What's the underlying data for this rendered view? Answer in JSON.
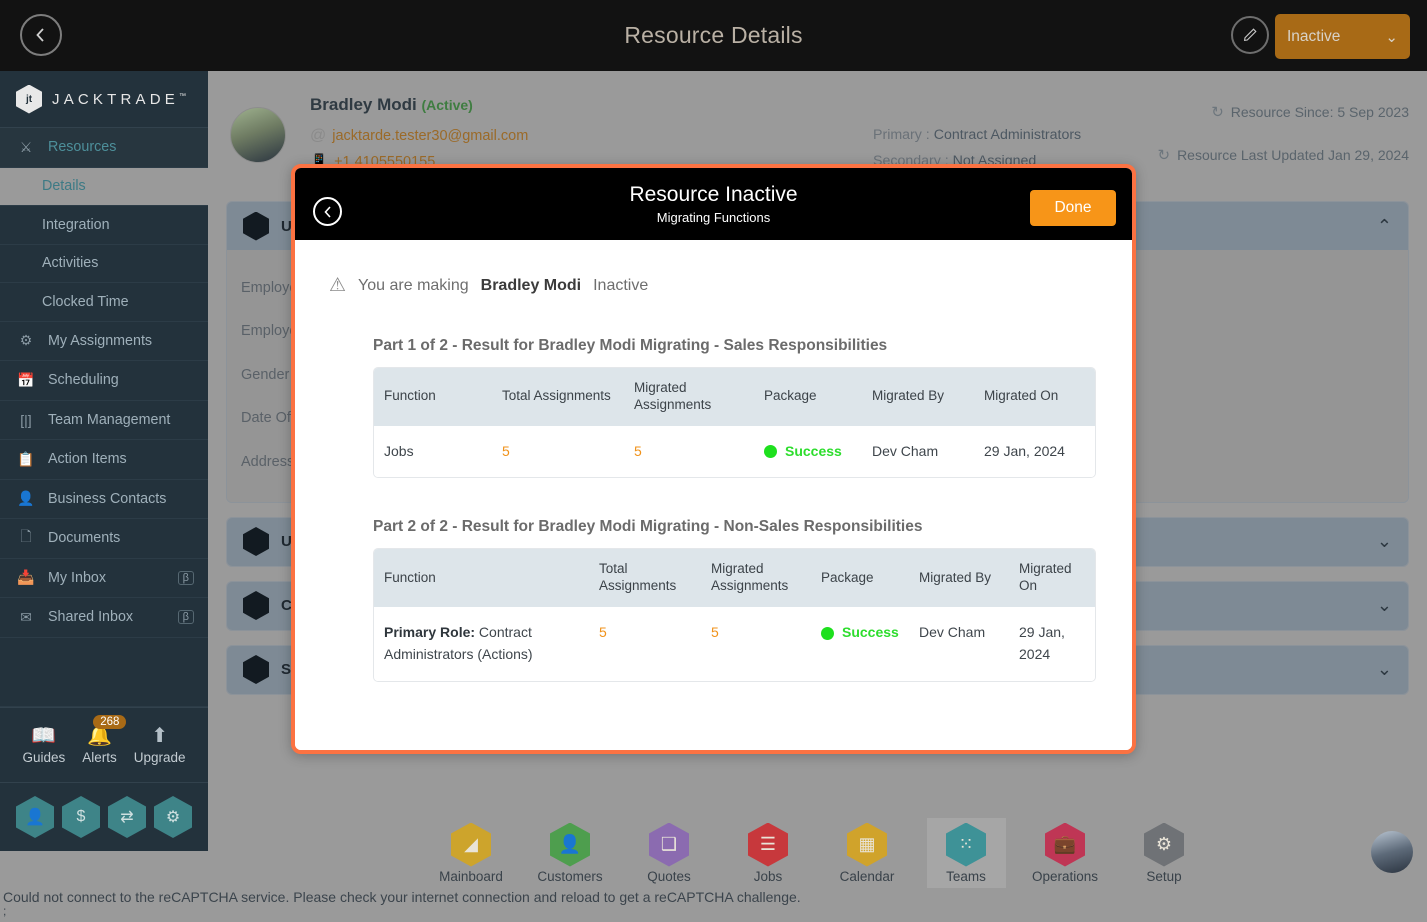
{
  "topbar": {
    "back_icon": "chevron-left-icon",
    "title": "Resource Details",
    "edit_icon": "pencil-icon",
    "status_value": "Inactive",
    "status_caret": "⌄",
    "accent_orange": "#a86a16"
  },
  "sidebar": {
    "brand": "JACKTRADE",
    "brand_tm": "™",
    "items": [
      {
        "label": "Resources",
        "icon": "resources-icon",
        "accent": true
      },
      {
        "label": "Details",
        "sub": true,
        "active": true
      },
      {
        "label": "Integration",
        "sub": true
      },
      {
        "label": "Activities",
        "sub": true
      },
      {
        "label": "Clocked Time",
        "sub": true
      },
      {
        "label": "My Assignments",
        "icon": "assignments-icon"
      },
      {
        "label": "Scheduling",
        "icon": "calendar-clock-icon"
      },
      {
        "label": "Team Management",
        "icon": "team-icon"
      },
      {
        "label": "Action Items",
        "icon": "clipboard-icon"
      },
      {
        "label": "Business Contacts",
        "icon": "contact-card-icon"
      },
      {
        "label": "Documents",
        "icon": "documents-icon"
      },
      {
        "label": "My Inbox",
        "icon": "inbox-icon",
        "badge": "β"
      },
      {
        "label": "Shared Inbox",
        "icon": "envelope-icon",
        "badge": "β"
      }
    ],
    "quick": [
      {
        "label": "Guides",
        "icon": "book-icon"
      },
      {
        "label": "Alerts",
        "icon": "bell-icon",
        "count": "268"
      },
      {
        "label": "Upgrade",
        "icon": "up-arrow-icon"
      }
    ],
    "hex_shortcuts": [
      {
        "icon": "person-icon",
        "glyph": "👤"
      },
      {
        "icon": "dollar-icon",
        "glyph": "$"
      },
      {
        "icon": "cash-transfer-icon",
        "glyph": "⇄"
      },
      {
        "icon": "workflow-icon",
        "glyph": "⚙"
      }
    ]
  },
  "profile": {
    "name": "Bradley Modi",
    "status": "(Active)",
    "email": "jacktarde.tester30@gmail.com",
    "phone": "+1 4105550155",
    "primary_label": "Primary :",
    "primary_value": "Contract Administrators",
    "secondary_label": "Secondary :",
    "secondary_value": "Not Assigned",
    "resource_since": "Resource Since: 5 Sep 2023",
    "last_updated": "Resource Last Updated Jan 29, 2024"
  },
  "panels": [
    {
      "title": "User Profile",
      "chevron": "⌃",
      "expanded": true,
      "fields": [
        "Employee ID",
        "Employee Type",
        "Gender",
        "Date Of Birth",
        "Address"
      ]
    },
    {
      "title": "User Access",
      "chevron": "⌄",
      "expanded": false
    },
    {
      "title": "Compensation",
      "chevron": "⌄",
      "expanded": false
    },
    {
      "title": "Skills",
      "chevron": "⌄",
      "expanded": false
    }
  ],
  "bottomnav": {
    "items": [
      {
        "label": "Mainboard",
        "color": "#cda42c",
        "glyph": "◤",
        "icon": "mainboard-icon"
      },
      {
        "label": "Customers",
        "color": "#4e9e4e",
        "glyph": "👤",
        "icon": "customers-icon"
      },
      {
        "label": "Quotes",
        "color": "#8b6bb0",
        "glyph": "❐",
        "icon": "quotes-icon"
      },
      {
        "label": "Jobs",
        "color": "#c7383c",
        "glyph": "☰",
        "icon": "jobs-icon"
      },
      {
        "label": "Calendar",
        "color": "#d0a32b",
        "glyph": "▦",
        "icon": "calendar-icon"
      },
      {
        "label": "Teams",
        "color": "#3e9297",
        "glyph": "⁘",
        "icon": "teams-icon",
        "selected": true
      },
      {
        "label": "Operations",
        "color": "#bf3655",
        "glyph": "💼",
        "icon": "operations-icon"
      },
      {
        "label": "Setup",
        "color": "#6f7276",
        "glyph": "⚙",
        "icon": "setup-icon"
      }
    ],
    "avatar": "user-avatar"
  },
  "statusbar": {
    "message": "Could not connect to the reCAPTCHA service. Please check your internet connection and reload to get a reCAPTCHA challenge.",
    "secondary": ";"
  },
  "modal": {
    "back_icon": "chevron-left-icon",
    "title": "Resource Inactive",
    "subtitle": "Migrating Functions",
    "done_label": "Done",
    "warning_icon": "warning-triangle-icon",
    "warning_prefix": "You are making",
    "warning_name": "Bradley Modi",
    "warning_suffix": "Inactive",
    "border_color": "#fb7242",
    "sections": [
      {
        "title": "Part 1 of 2 - Result for Bradley Modi Migrating - Sales Responsibilities",
        "columns": [
          "Function",
          "Total Assignments",
          "Migrated Assignments",
          "Package",
          "Migrated By",
          "Migrated On"
        ],
        "rows": [
          {
            "function_bold": "",
            "function": "Jobs",
            "total": "5",
            "migrated": "5",
            "package": "Success",
            "package_color": "#2ddd2d",
            "by": "Dev Cham",
            "on": "29 Jan, 2024"
          }
        ]
      },
      {
        "title": "Part 2 of 2 - Result for Bradley Modi Migrating - Non-Sales Responsibilities",
        "columns": [
          "Function",
          "Total Assignments",
          "Migrated Assignments",
          "Package",
          "Migrated By",
          "Migrated On"
        ],
        "rows": [
          {
            "function_bold": "Primary Role:",
            "function": " Contract Administrators (Actions)",
            "total": "5",
            "migrated": "5",
            "package": "Success",
            "package_color": "#2ddd2d",
            "by": "Dev Cham",
            "on": "29 Jan, 2024"
          }
        ]
      }
    ]
  }
}
